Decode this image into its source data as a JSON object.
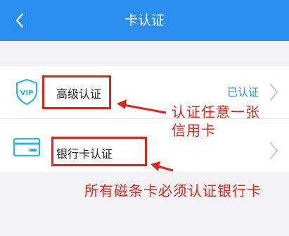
{
  "header": {
    "title": "卡认证",
    "back_icon": "chevron-left-icon",
    "background": "#2a8df0"
  },
  "list": {
    "items": [
      {
        "label": "高级认证",
        "status": "已认证",
        "icon": "vip-shield-icon"
      },
      {
        "label": "银行卡认证",
        "status": "",
        "icon": "bank-card-icon"
      }
    ]
  },
  "annotations": {
    "note1_line1": "认证任意一张",
    "note1_line2": "信用卡",
    "note2": "所有磁条卡必须认证银行卡",
    "color": "#e0231b"
  }
}
